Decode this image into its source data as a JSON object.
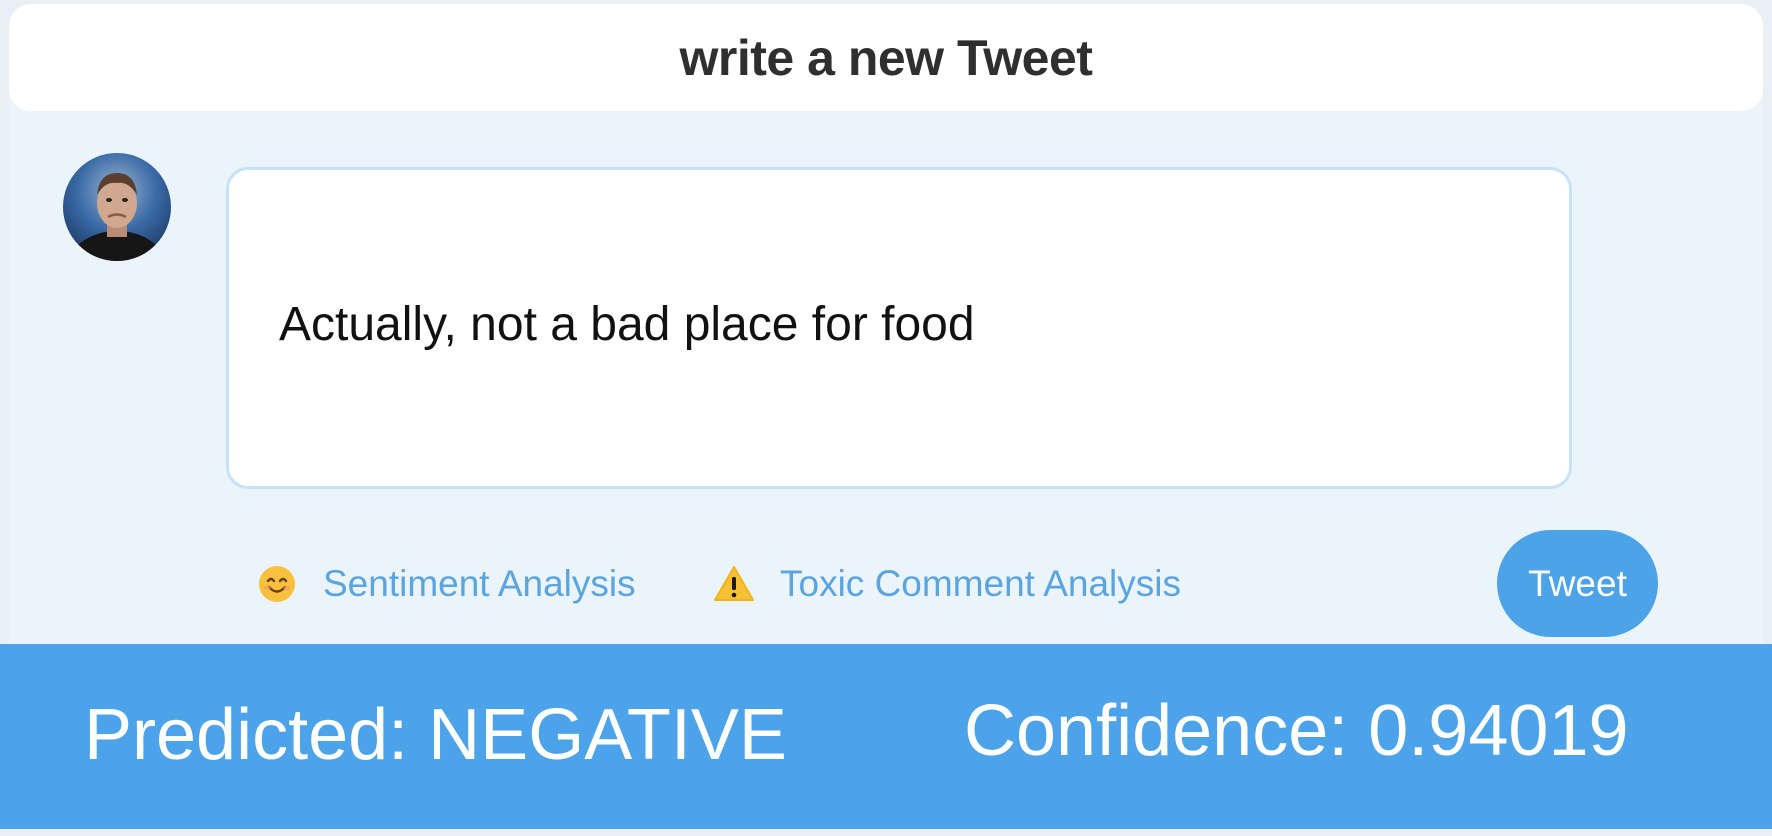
{
  "header": {
    "title": "write a new Tweet"
  },
  "composer": {
    "avatar_icon": "user-avatar-photo",
    "tweet_text": "Actually, not a bad place for food"
  },
  "tools": {
    "sentiment": {
      "icon": "smiling-face-icon",
      "label": "Sentiment Analysis"
    },
    "toxic": {
      "icon": "warning-icon",
      "label": "Toxic Comment Analysis"
    }
  },
  "tweet_button": {
    "label": "Tweet"
  },
  "result": {
    "predicted": "Predicted: NEGATIVE",
    "confidence": "Confidence: 0.94019"
  },
  "colors": {
    "accent": "#4da3e8",
    "link": "#5aa4e0",
    "composer_bg": "#ebf4fb",
    "input_border": "#c7e1f7"
  }
}
